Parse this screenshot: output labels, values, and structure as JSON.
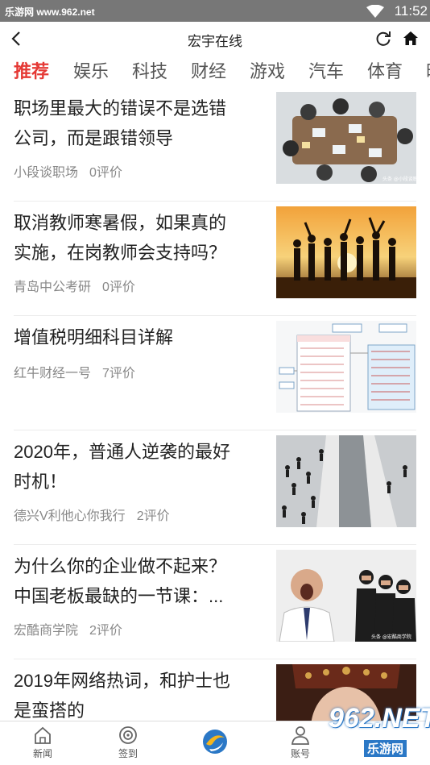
{
  "status_bar": {
    "site": "乐游网 www.962.net",
    "time": "11:52"
  },
  "title_bar": {
    "title": "宏宇在线"
  },
  "tabs": [
    "推荐",
    "娱乐",
    "科技",
    "财经",
    "游戏",
    "汽车",
    "体育",
    "时"
  ],
  "feed": [
    {
      "title_lines": [
        "职场里最大的错误不是选错",
        "公司，而是跟错领导"
      ],
      "source": "小段谈职场",
      "comments": "0评价",
      "thumb_mark": "头条 @小段谈职场"
    },
    {
      "title_lines": [
        "取消教师寒暑假，如果真的",
        "实施，在岗教师会支持吗？"
      ],
      "source": "青岛中公考研",
      "comments": "0评价"
    },
    {
      "title_lines": [
        "增值税明细科目详解"
      ],
      "source": "红牛财经一号",
      "comments": "7评价"
    },
    {
      "title_lines": [
        "2020年，普通人逆袭的最好",
        "时机！"
      ],
      "source": "德兴V利他心你我行",
      "comments": "2评价"
    },
    {
      "title_lines": [
        "为什么你的企业做不起来？",
        "中国老板最缺的一节课：..."
      ],
      "source": "宏酷商学院",
      "comments": "2评价",
      "thumb_mark": "头条 @宏酷商学院"
    },
    {
      "title_lines": [
        "2019年网络热词，和护士也",
        "是蛮搭的"
      ],
      "source": "",
      "comments": ""
    }
  ],
  "bottom_nav": {
    "news": "新闻",
    "checkin": "签到",
    "account": "账号"
  },
  "watermark": {
    "number": "962.NET",
    "label": "乐游网"
  },
  "colors": {
    "accent": "#e53935",
    "statusbar": "#777777",
    "brand_blue": "#2b78c6"
  }
}
